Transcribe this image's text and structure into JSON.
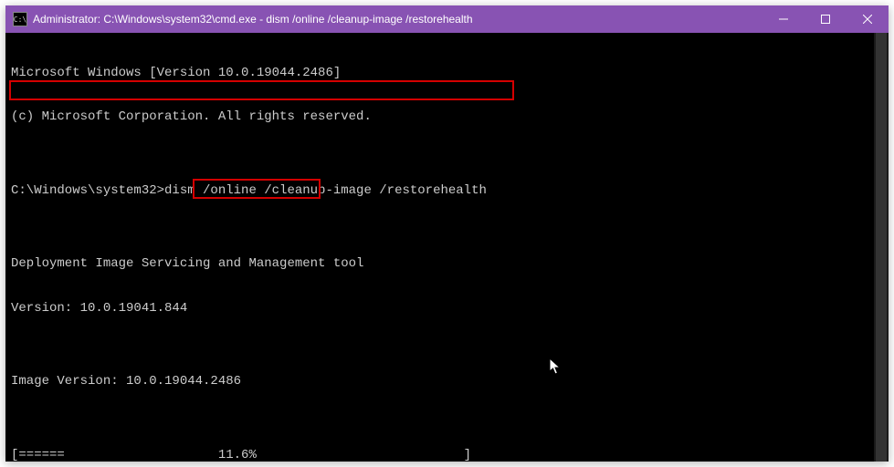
{
  "titlebar": {
    "icon_text": "C:\\",
    "title": "Administrator: C:\\Windows\\system32\\cmd.exe - dism  /online /cleanup-image /restorehealth"
  },
  "console": {
    "line1": "Microsoft Windows [Version 10.0.19044.2486]",
    "line2": "(c) Microsoft Corporation. All rights reserved.",
    "blank1": "",
    "prompt_line": "C:\\Windows\\system32>dism /online /cleanup-image /restorehealth",
    "blank2": "",
    "line3": "Deployment Image Servicing and Management tool",
    "line4": "Version: 10.0.19041.844",
    "blank3": "",
    "line5": "Image Version: 10.0.19044.2486",
    "blank4": "",
    "progress_line": "[======                    11.6%                           ]"
  }
}
